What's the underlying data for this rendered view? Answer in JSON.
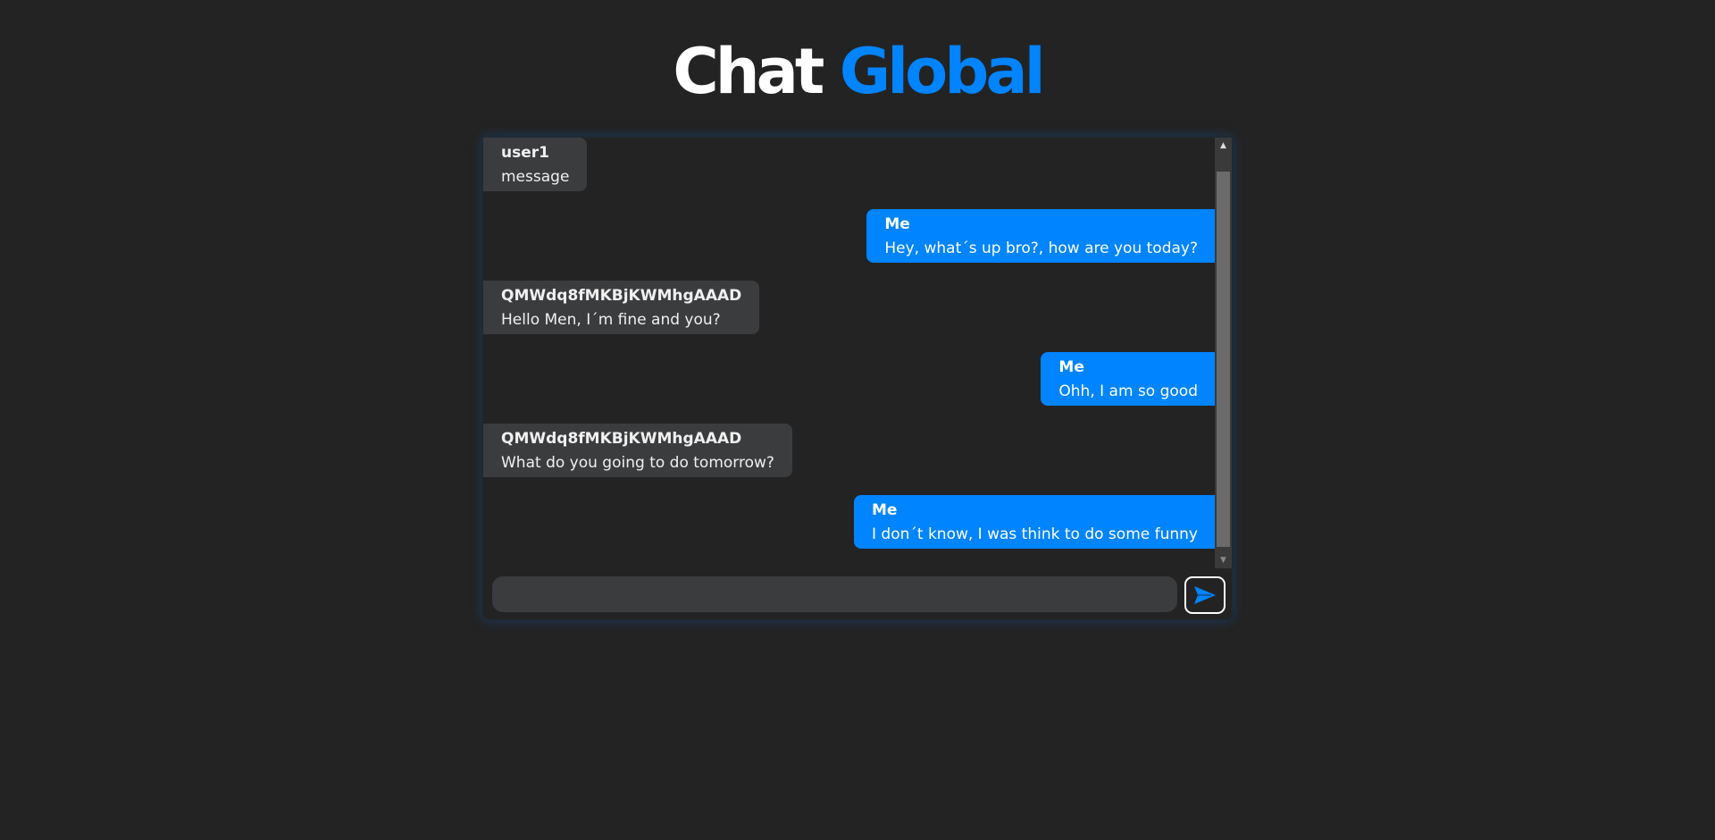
{
  "header": {
    "title_part1": "Chat",
    "title_part2": "Global"
  },
  "colors": {
    "accent": "#0084ff",
    "background": "#232323",
    "other_bubble": "#3b3c3e"
  },
  "messages": [
    {
      "sender": "user1",
      "text": "message",
      "mine": false
    },
    {
      "sender": "Me",
      "text": "Hey, what´s up bro?, how are you today?",
      "mine": true
    },
    {
      "sender": "QMWdq8fMKBjKWMhgAAAD",
      "text": "Hello Men, I´m fine and you?",
      "mine": false
    },
    {
      "sender": "Me",
      "text": "Ohh, I am so good",
      "mine": true
    },
    {
      "sender": "QMWdq8fMKBjKWMhgAAAD",
      "text": "What do you going to do tomorrow?",
      "mine": false
    },
    {
      "sender": "Me",
      "text": "I don´t know, I was think to do some funny",
      "mine": true
    }
  ],
  "composer": {
    "value": "",
    "send_icon": "paper-plane-icon"
  }
}
